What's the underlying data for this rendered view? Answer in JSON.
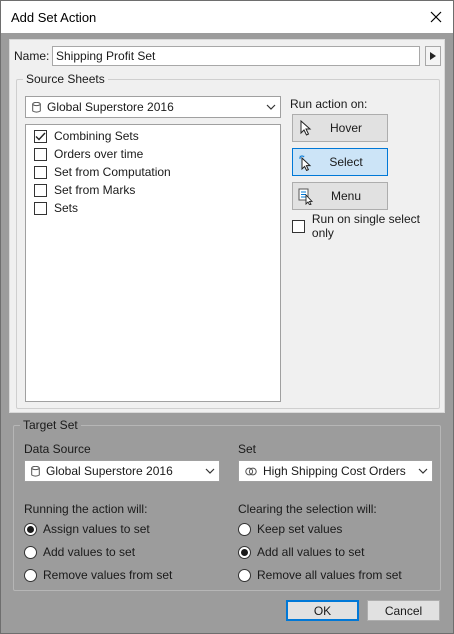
{
  "dialog": {
    "title": "Add Set Action"
  },
  "name": {
    "label": "Name:",
    "value": "Shipping Profit Set"
  },
  "source_sheets": {
    "legend": "Source Sheets",
    "datasource": "Global Superstore 2016",
    "sheets": [
      {
        "label": "Combining Sets",
        "checked": true
      },
      {
        "label": "Orders over time",
        "checked": false
      },
      {
        "label": "Set from Computation",
        "checked": false
      },
      {
        "label": "Set from Marks",
        "checked": false
      },
      {
        "label": "Sets",
        "checked": false
      }
    ]
  },
  "run_action": {
    "label": "Run action on:",
    "buttons": [
      {
        "label": "Hover",
        "icon": "pointer-icon",
        "selected": false
      },
      {
        "label": "Select",
        "icon": "select-click-icon",
        "selected": true
      },
      {
        "label": "Menu",
        "icon": "menu-icon",
        "selected": false
      }
    ],
    "single_select_label": "Run on single select only",
    "single_select_checked": false
  },
  "target_set": {
    "legend": "Target Set",
    "data_source_label": "Data Source",
    "data_source_value": "Global Superstore 2016",
    "set_label": "Set",
    "set_value": "High Shipping Cost Orders"
  },
  "running_action": {
    "label": "Running the action will:",
    "options": [
      {
        "label": "Assign values to set",
        "selected": true
      },
      {
        "label": "Add values to set",
        "selected": false
      },
      {
        "label": "Remove values from set",
        "selected": false
      }
    ]
  },
  "clearing_selection": {
    "label": "Clearing the selection will:",
    "options": [
      {
        "label": "Keep set values",
        "selected": false
      },
      {
        "label": "Add all values to set",
        "selected": true
      },
      {
        "label": "Remove all values from set",
        "selected": false
      }
    ]
  },
  "footer": {
    "ok_label": "OK",
    "cancel_label": "Cancel"
  },
  "colors": {
    "accent": "#0078d7",
    "selected_bg": "#cce4f7",
    "dimmed_bg": "#9c9c9c"
  }
}
